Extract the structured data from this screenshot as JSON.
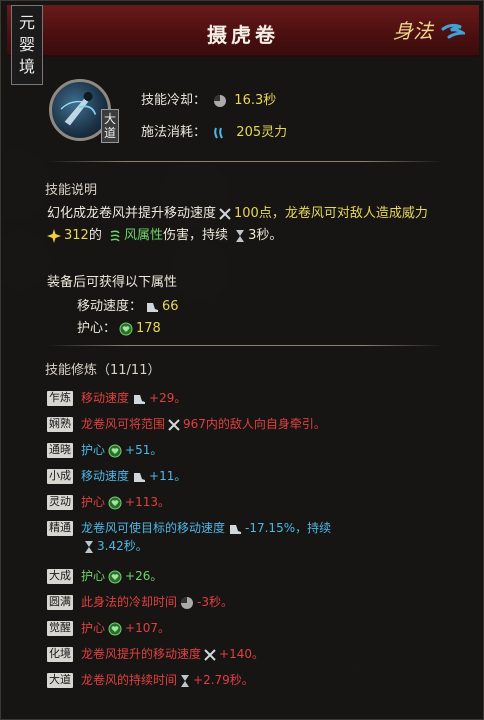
{
  "header": {
    "realm_chars": [
      "元",
      "婴",
      "境"
    ],
    "title": "摄虎卷",
    "category": "身法"
  },
  "skill": {
    "tier_chars": [
      "大",
      "道"
    ],
    "cooldown_label": "技能冷却：",
    "cooldown_value": "16.3秒",
    "cost_label": "施法消耗：",
    "cost_value": "205灵力"
  },
  "description": {
    "title": "技能说明",
    "line1_a": "幻化成龙卷风并提升移动速度",
    "line1_b": "100点，龙卷风可对敌人造成威力",
    "line2_value": "312",
    "line2_a": "的",
    "line2_element": "风属性",
    "line2_b": "伤害，持续",
    "line2_duration": "3秒。"
  },
  "equip_bonus": {
    "title": "装备后可获得以下属性",
    "items": [
      {
        "label": "移动速度：",
        "value": "66"
      },
      {
        "label": "护心：",
        "value": "178"
      }
    ]
  },
  "cultivation": {
    "title": "技能修炼（11/11）",
    "mods": [
      {
        "tag": "乍炼",
        "color": "red",
        "text": "移动速度",
        "icon": "speed-icon",
        "value": "+29。"
      },
      {
        "tag": "娴熟",
        "color": "red",
        "text": "龙卷风可将范围",
        "icon": "range-icon",
        "value": "967内的敌人向自身牵引。"
      },
      {
        "tag": "通晓",
        "color": "blue",
        "text": "护心",
        "icon": "heart-shield-icon",
        "value": "+51。"
      },
      {
        "tag": "小成",
        "color": "blue",
        "text": "移动速度",
        "icon": "speed-icon",
        "value": "+11。"
      },
      {
        "tag": "灵动",
        "color": "red",
        "text": "护心",
        "icon": "heart-shield-icon",
        "value": "+113。"
      },
      {
        "tag": "精通",
        "color": "blue",
        "text": "龙卷风可使目标的移动速度",
        "icon": "speed-icon",
        "value": "-17.15%，持续",
        "line2_icon": "hourglass-icon",
        "line2": "3.42秒。"
      },
      {
        "tag": "大成",
        "color": "green",
        "text": "护心",
        "icon": "heart-shield-icon",
        "value": "+26。"
      },
      {
        "tag": "圆满",
        "color": "red",
        "text": "此身法的冷却时间",
        "icon": "cooldown-icon",
        "value": "-3秒。"
      },
      {
        "tag": "觉醒",
        "color": "red",
        "text": "护心",
        "icon": "heart-shield-icon",
        "value": "+107。"
      },
      {
        "tag": "化境",
        "color": "red",
        "text": "龙卷风提升的移动速度",
        "icon": "range-icon",
        "value": "+140。"
      },
      {
        "tag": "大道",
        "color": "red",
        "text": "龙卷风的持续时间",
        "icon": "hourglass-icon",
        "value": "+2.79秒。"
      }
    ]
  },
  "colors": {
    "header_red": "#6a1a1a",
    "highlight_yellow": "#e7d65a",
    "mod_red": "#e04040",
    "mod_blue": "#4fb7e6",
    "mod_green": "#6fd36b"
  }
}
